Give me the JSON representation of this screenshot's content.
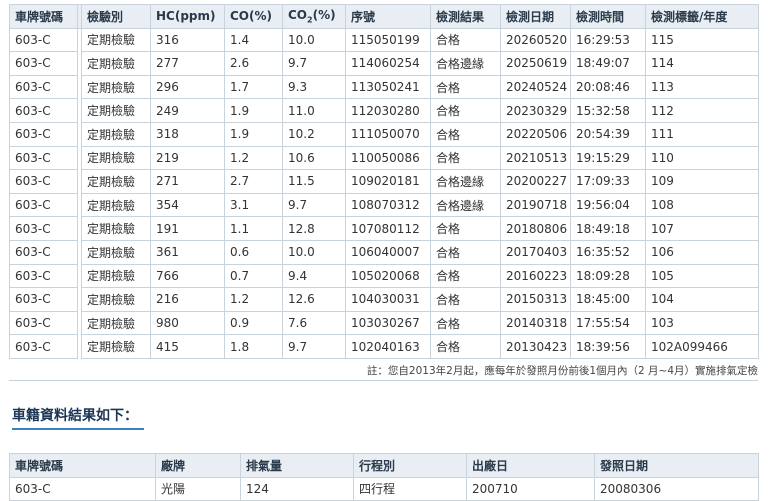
{
  "inspection": {
    "headers": {
      "plate": "車牌號碼",
      "type": "檢驗別",
      "hc": "HC(ppm)",
      "co": "CO(%)",
      "co2_pre": "CO",
      "co2_sub": "2",
      "co2_post": "(%)",
      "serial": "序號",
      "result": "檢測結果",
      "date": "檢測日期",
      "time": "檢測時間",
      "label": "檢測標籤/年度"
    },
    "rows": [
      {
        "plate": "603-C",
        "type": "定期檢驗",
        "hc": "316",
        "co": "1.4",
        "co2": "10.0",
        "serial": "115050199",
        "result": "合格",
        "date": "20260520",
        "time": "16:29:53",
        "label": "115"
      },
      {
        "plate": "603-C",
        "type": "定期檢驗",
        "hc": "277",
        "co": "2.6",
        "co2": "9.7",
        "serial": "114060254",
        "result": "合格邊緣",
        "date": "20250619",
        "time": "18:49:07",
        "label": "114"
      },
      {
        "plate": "603-C",
        "type": "定期檢驗",
        "hc": "296",
        "co": "1.7",
        "co2": "9.3",
        "serial": "113050241",
        "result": "合格",
        "date": "20240524",
        "time": "20:08:46",
        "label": "113"
      },
      {
        "plate": "603-C",
        "type": "定期檢驗",
        "hc": "249",
        "co": "1.9",
        "co2": "11.0",
        "serial": "112030280",
        "result": "合格",
        "date": "20230329",
        "time": "15:32:58",
        "label": "112"
      },
      {
        "plate": "603-C",
        "type": "定期檢驗",
        "hc": "318",
        "co": "1.9",
        "co2": "10.2",
        "serial": "111050070",
        "result": "合格",
        "date": "20220506",
        "time": "20:54:39",
        "label": "111"
      },
      {
        "plate": "603-C",
        "type": "定期檢驗",
        "hc": "219",
        "co": "1.2",
        "co2": "10.6",
        "serial": "110050086",
        "result": "合格",
        "date": "20210513",
        "time": "19:15:29",
        "label": "110"
      },
      {
        "plate": "603-C",
        "type": "定期檢驗",
        "hc": "271",
        "co": "2.7",
        "co2": "11.5",
        "serial": "109020181",
        "result": "合格邊緣",
        "date": "20200227",
        "time": "17:09:33",
        "label": "109"
      },
      {
        "plate": "603-C",
        "type": "定期檢驗",
        "hc": "354",
        "co": "3.1",
        "co2": "9.7",
        "serial": "108070312",
        "result": "合格邊緣",
        "date": "20190718",
        "time": "19:56:04",
        "label": "108"
      },
      {
        "plate": "603-C",
        "type": "定期檢驗",
        "hc": "191",
        "co": "1.1",
        "co2": "12.8",
        "serial": "107080112",
        "result": "合格",
        "date": "20180806",
        "time": "18:49:18",
        "label": "107"
      },
      {
        "plate": "603-C",
        "type": "定期檢驗",
        "hc": "361",
        "co": "0.6",
        "co2": "10.0",
        "serial": "106040007",
        "result": "合格",
        "date": "20170403",
        "time": "16:35:52",
        "label": "106"
      },
      {
        "plate": "603-C",
        "type": "定期檢驗",
        "hc": "766",
        "co": "0.7",
        "co2": "9.4",
        "serial": "105020068",
        "result": "合格",
        "date": "20160223",
        "time": "18:09:28",
        "label": "105"
      },
      {
        "plate": "603-C",
        "type": "定期檢驗",
        "hc": "216",
        "co": "1.2",
        "co2": "12.6",
        "serial": "104030031",
        "result": "合格",
        "date": "20150313",
        "time": "18:45:00",
        "label": "104"
      },
      {
        "plate": "603-C",
        "type": "定期檢驗",
        "hc": "980",
        "co": "0.9",
        "co2": "7.6",
        "serial": "103030267",
        "result": "合格",
        "date": "20140318",
        "time": "17:55:54",
        "label": "103"
      },
      {
        "plate": "603-C",
        "type": "定期檢驗",
        "hc": "415",
        "co": "1.8",
        "co2": "9.7",
        "serial": "102040163",
        "result": "合格",
        "date": "20130423",
        "time": "18:39:56",
        "label": "102A099466"
      }
    ]
  },
  "note": "註：您自2013年2月起，應每年於發照月份前後1個月內（2 月~4月）實施排氣定檢",
  "registration": {
    "title": "車籍資料結果如下：",
    "headers": {
      "plate": "車牌號碼",
      "brand": "廠牌",
      "displacement": "排氣量",
      "stroke": "行程別",
      "factory": "出廠日",
      "issue": "發照日期"
    },
    "row": {
      "plate": "603-C",
      "brand": "光陽",
      "displacement": "124",
      "stroke": "四行程",
      "factory": "200710",
      "issue": "20080306"
    }
  }
}
